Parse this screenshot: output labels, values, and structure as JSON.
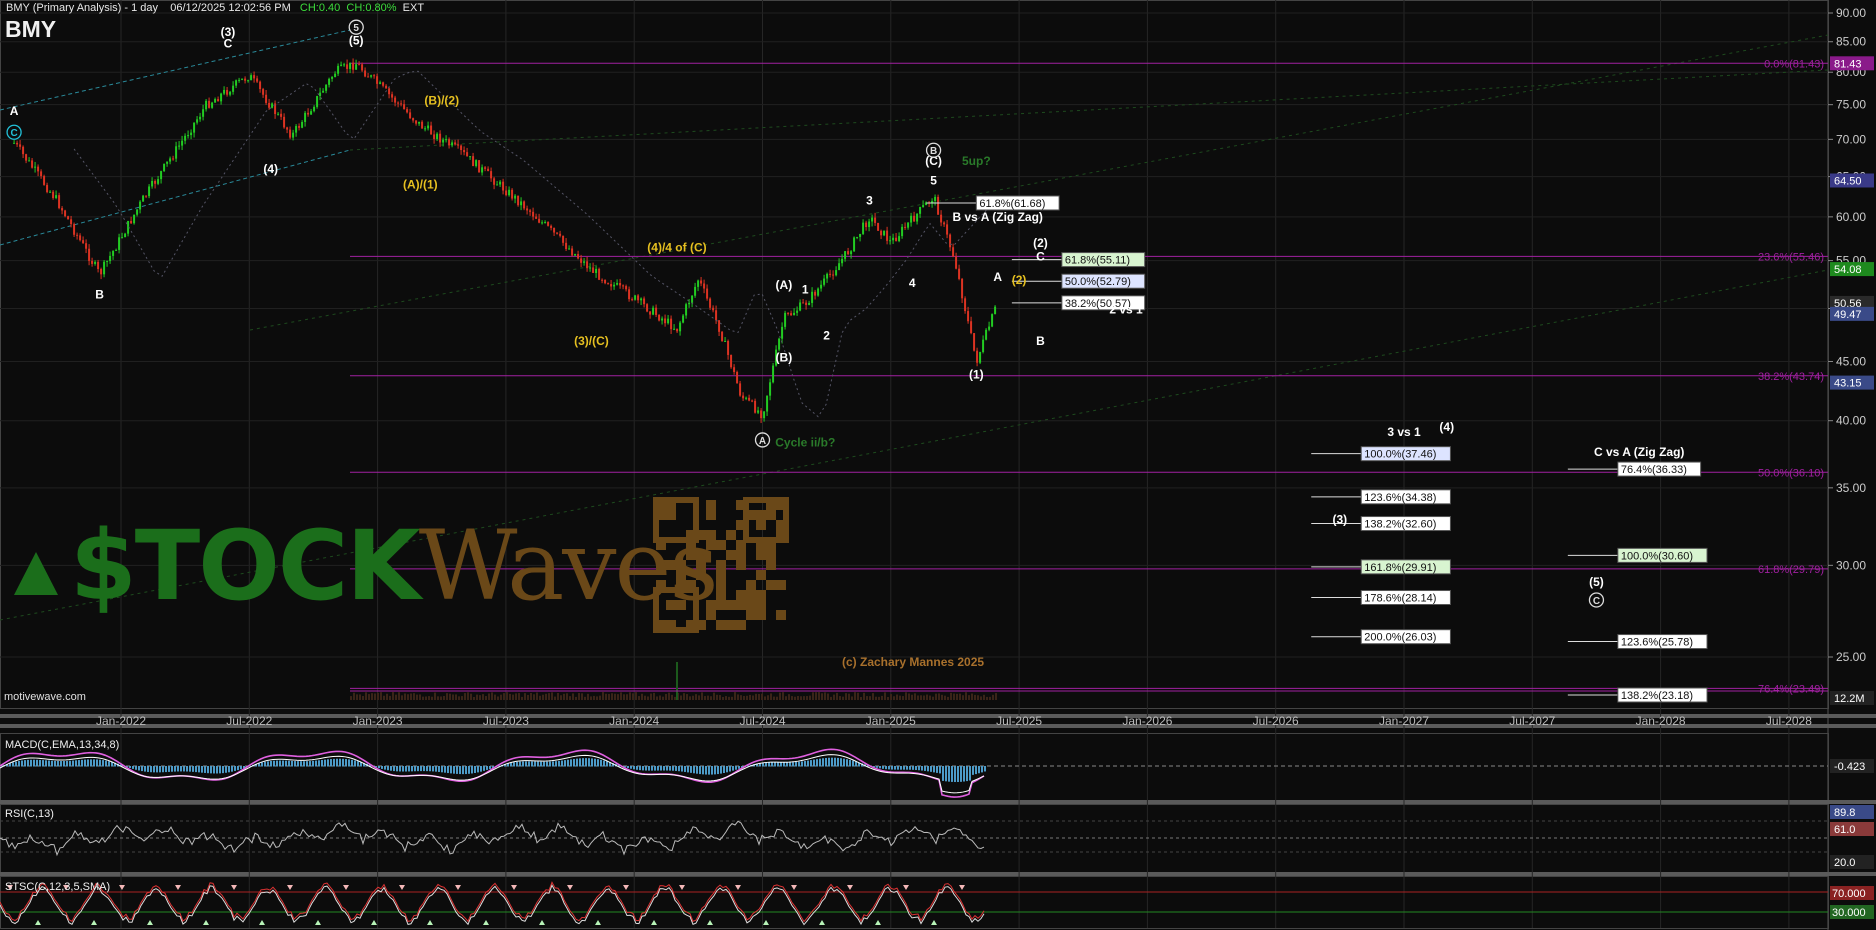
{
  "header": {
    "title": "BMY (Primary Analysis) - 1 day",
    "datetime": "06/12/2025 12:02:56 PM",
    "change": "CH:0.40",
    "change_pct": "CH:0.80%",
    "session": "EXT",
    "symbol": "BMY"
  },
  "watermark": {
    "stock": "$TOCK",
    "waves": "Waves",
    "copyright": "(c) Zachary Mannes 2025",
    "source": "motivewave.com"
  },
  "colors": {
    "background": "#0c0c0c",
    "fib_line": "#a020a0",
    "bull_candle": "#22cc22",
    "bear_candle": "#dd3322",
    "macd_line": "#e060e0",
    "macd_hist": "#4d9bc8",
    "wave_yellow": "#e6c020",
    "wave_white": "#ffffff"
  },
  "chart_data": {
    "type": "line",
    "title": "BMY (Primary Analysis) - 1 day",
    "y_scale": "log",
    "ylim": [
      23,
      92
    ],
    "y_ticks": [
      25,
      30,
      35,
      40,
      45,
      50,
      55,
      60,
      65,
      70,
      75,
      80,
      85,
      90
    ],
    "y_tick_labels": [
      "25.00",
      "30.00",
      "35.00",
      "40.00",
      "45.00",
      "50.00",
      "55.00",
      "60.00",
      "65.00",
      "70.00",
      "75.00",
      "80.00",
      "85.00",
      "90.00"
    ],
    "x_tick_labels": [
      "Jan-2022",
      "Jul-2022",
      "Jan-2023",
      "Jul-2023",
      "Jan-2024",
      "Jul-2024",
      "Jan-2025",
      "Jul-2025",
      "Jan-2026",
      "Jul-2026",
      "Jan-2027",
      "Jul-2027",
      "Jan-2028",
      "Jul-2028"
    ],
    "x_tick_dates": [
      "2022-01",
      "2022-07",
      "2023-01",
      "2023-07",
      "2024-01",
      "2024-07",
      "2025-01",
      "2025-07",
      "2026-01",
      "2026-07",
      "2027-01",
      "2027-07",
      "2028-01",
      "2028-07"
    ],
    "price_path": {
      "dates": [
        "2021-08",
        "2021-10",
        "2021-12",
        "2022-02",
        "2022-05",
        "2022-07",
        "2022-09",
        "2022-11",
        "2022-12",
        "2023-03",
        "2023-05",
        "2023-08",
        "2023-11",
        "2024-01",
        "2024-03",
        "2024-04",
        "2024-05",
        "2024-06",
        "2024-07",
        "2024-08",
        "2024-09",
        "2024-10",
        "2024-11",
        "2024-12",
        "2025-01",
        "2025-03",
        "2025-04",
        "2025-05",
        "2025-06"
      ],
      "values": [
        69.5,
        62,
        53.5,
        62,
        75,
        79.5,
        70.5,
        80,
        81.4,
        72,
        68,
        61,
        54,
        51,
        48,
        53,
        48,
        42,
        40.5,
        49,
        50.5,
        53,
        56,
        60,
        57,
        62.5,
        55,
        45,
        50.6
      ]
    },
    "current_price": "50.56",
    "axis_badges": [
      {
        "value": 81.43,
        "label": "81.43",
        "color": "#8a1a8a"
      },
      {
        "value": 64.5,
        "label": "64.50",
        "color": "#3a3a88"
      },
      {
        "value": 54.08,
        "label": "54.08",
        "color": "#1e8a1e"
      },
      {
        "value": 50.56,
        "label": "50.56",
        "color": "#2a2a2a"
      },
      {
        "value": 49.47,
        "label": "49.47",
        "color": "#3a4a88"
      },
      {
        "value": 43.15,
        "label": "43.15",
        "color": "#3a4a88"
      },
      {
        "value": 12.2,
        "label": "12.2M",
        "color": "#222"
      }
    ],
    "fib_lines": [
      {
        "value": 81.43,
        "label": "0.0%(81.43)"
      },
      {
        "value": 55.46,
        "label": "23.6%(55.46)"
      },
      {
        "value": 43.74,
        "label": "38.2%(43.74)"
      },
      {
        "value": 36.1,
        "label": "50.0%(36.10)"
      },
      {
        "value": 29.79,
        "label": "61.8%(29.79)"
      },
      {
        "value": 23.49,
        "label": "76.4%(23.49)"
      }
    ],
    "fib_boxes": [
      {
        "value": 61.68,
        "label": "61.8%(61.68)",
        "x": "2025-05",
        "bg": "#ffffff"
      },
      {
        "value": 55.11,
        "label": "61.8%(55.11)",
        "x": "2025-09",
        "bg": "#d8f4d0"
      },
      {
        "value": 52.79,
        "label": "50.0%(52.79)",
        "x": "2025-09",
        "bg": "#dde4ff"
      },
      {
        "value": 50.57,
        "label": "38.2%(50.57)",
        "x": "2025-09",
        "bg": "#ffffff"
      },
      {
        "value": 37.46,
        "label": "100.0%(37.46)",
        "x": "2026-11",
        "bg": "#dde4ff"
      },
      {
        "value": 34.38,
        "label": "123.6%(34.38)",
        "x": "2026-11",
        "bg": "#ffffff"
      },
      {
        "value": 32.6,
        "label": "138.2%(32.60)",
        "x": "2026-11",
        "bg": "#ffffff"
      },
      {
        "value": 29.91,
        "label": "161.8%(29.91)",
        "x": "2026-11",
        "bg": "#d8f4d0"
      },
      {
        "value": 28.14,
        "label": "178.6%(28.14)",
        "x": "2026-11",
        "bg": "#ffffff"
      },
      {
        "value": 26.03,
        "label": "200.0%(26.03)",
        "x": "2026-11",
        "bg": "#ffffff"
      },
      {
        "value": 36.33,
        "label": "76.4%(36.33)",
        "x": "2027-11",
        "bg": "#ffffff"
      },
      {
        "value": 30.6,
        "label": "100.0%(30.60)",
        "x": "2027-11",
        "bg": "#d8f4d0"
      },
      {
        "value": 25.78,
        "label": "123.6%(25.78)",
        "x": "2027-11",
        "bg": "#ffffff"
      },
      {
        "value": 23.18,
        "label": "138.2%(23.18)",
        "x": "2027-11",
        "bg": "#ffffff"
      }
    ],
    "annotations": [
      {
        "text": "A",
        "x": "2021-08",
        "y": 73.5,
        "color": "#ffffff"
      },
      {
        "text": "B",
        "x": "2021-12",
        "y": 51,
        "color": "#ffffff"
      },
      {
        "text": "(3)",
        "x": "2022-06",
        "y": 86,
        "color": "#ffffff"
      },
      {
        "text": "C",
        "x": "2022-06",
        "y": 84,
        "color": "#ffffff"
      },
      {
        "text": "(4)",
        "x": "2022-08",
        "y": 65.5,
        "color": "#ffffff"
      },
      {
        "text": "(5)",
        "x": "2022-12",
        "y": 84.5,
        "color": "#ffffff"
      },
      {
        "text": "(B)/(2)",
        "x": "2023-04",
        "y": 75,
        "color": "#e6c020"
      },
      {
        "text": "(A)/(1)",
        "x": "2023-03",
        "y": 63.5,
        "color": "#e6c020"
      },
      {
        "text": "(4)/4 of (C)",
        "x": "2024-03",
        "y": 56,
        "color": "#e6c020"
      },
      {
        "text": "(3)/(C)",
        "x": "2023-11",
        "y": 46.5,
        "color": "#e6c020"
      },
      {
        "text": "(A)",
        "x": "2024-08",
        "y": 52,
        "color": "#ffffff"
      },
      {
        "text": "(B)",
        "x": "2024-08",
        "y": 45,
        "color": "#ffffff"
      },
      {
        "text": "1",
        "x": "2024-09",
        "y": 51.5,
        "color": "#ffffff"
      },
      {
        "text": "2",
        "x": "2024-10",
        "y": 47,
        "color": "#ffffff"
      },
      {
        "text": "3",
        "x": "2024-12",
        "y": 61.5,
        "color": "#ffffff"
      },
      {
        "text": "4",
        "x": "2025-02",
        "y": 52.2,
        "color": "#ffffff"
      },
      {
        "text": "5",
        "x": "2025-03",
        "y": 64,
        "color": "#ffffff"
      },
      {
        "text": "(C)",
        "x": "2025-03",
        "y": 66.5,
        "color": "#ffffff"
      },
      {
        "text": "5up?",
        "x": "2025-05",
        "y": 66.5,
        "color": "#2a7a2a"
      },
      {
        "text": "B vs A (Zig Zag)",
        "x": "2025-06",
        "y": 59.5,
        "color": "#ffffff"
      },
      {
        "text": "(2)",
        "x": "2025-08",
        "y": 56.5,
        "color": "#ffffff"
      },
      {
        "text": "C",
        "x": "2025-08",
        "y": 55,
        "color": "#ffffff"
      },
      {
        "text": "A",
        "x": "2025-06",
        "y": 52.8,
        "color": "#ffffff"
      },
      {
        "text": "(2)",
        "x": "2025-07",
        "y": 52.5,
        "color": "#e6c020"
      },
      {
        "text": "2 vs 1",
        "x": "2025-12",
        "y": 49.5,
        "color": "#ffffff"
      },
      {
        "text": "B",
        "x": "2025-08",
        "y": 46.5,
        "color": "#ffffff"
      },
      {
        "text": "(1)",
        "x": "2025-05",
        "y": 43.5,
        "color": "#ffffff"
      },
      {
        "text": "Cycle ii/b?",
        "x": "2024-09",
        "y": 38,
        "color": "#2a7a2a"
      },
      {
        "text": "3 vs 1",
        "x": "2027-01",
        "y": 38.8,
        "color": "#ffffff"
      },
      {
        "text": "(4)",
        "x": "2027-03",
        "y": 39.2,
        "color": "#ffffff"
      },
      {
        "text": "(3)",
        "x": "2026-10",
        "y": 32.6,
        "color": "#ffffff"
      },
      {
        "text": "C vs A (Zig Zag)",
        "x": "2027-12",
        "y": 37.3,
        "color": "#ffffff"
      },
      {
        "text": "(5)",
        "x": "2027-10",
        "y": 28.8,
        "color": "#ffffff"
      }
    ],
    "circled_labels": [
      {
        "text": "5",
        "x": "2022-12",
        "y": 87.5
      },
      {
        "text": "C",
        "x": "2021-08",
        "y": 71,
        "color": "#22c0d8"
      },
      {
        "text": "B",
        "x": "2025-03",
        "y": 68.5
      },
      {
        "text": "A",
        "x": "2024-07",
        "y": 38.5
      },
      {
        "text": "C",
        "x": "2027-10",
        "y": 28
      }
    ],
    "macd": {
      "label": "MACD(C,EMA,13,34,8)",
      "badge": "-0.423"
    },
    "rsi": {
      "label": "RSI(C,13)",
      "badges": [
        "89.8",
        "61.0",
        "20.0"
      ]
    },
    "stoch": {
      "label": "STSC(C,12,3,5,SMA)",
      "badges": [
        "70.000",
        "30.000"
      ]
    }
  }
}
